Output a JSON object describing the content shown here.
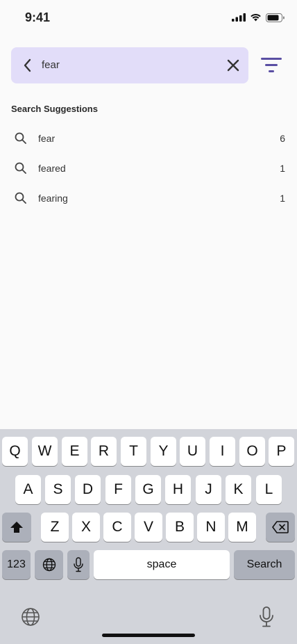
{
  "status_bar": {
    "time": "9:41"
  },
  "search": {
    "query": "fear"
  },
  "suggestions": {
    "title": "Search Suggestions",
    "items": [
      {
        "word": "fear",
        "count": "6"
      },
      {
        "word": "feared",
        "count": "1"
      },
      {
        "word": "fearing",
        "count": "1"
      }
    ]
  },
  "keyboard": {
    "row1": [
      "Q",
      "W",
      "E",
      "R",
      "T",
      "Y",
      "U",
      "I",
      "O",
      "P"
    ],
    "row2": [
      "A",
      "S",
      "D",
      "F",
      "G",
      "H",
      "J",
      "K",
      "L"
    ],
    "row3": [
      "Z",
      "X",
      "C",
      "V",
      "B",
      "N",
      "M"
    ],
    "numbers_label": "123",
    "space_label": "space",
    "return_label": "Search"
  },
  "colors": {
    "accent": "#5a4fa3",
    "search_bg": "#e2ddf9"
  },
  "icons": [
    "back-chevron-icon",
    "clear-x-icon",
    "filter-icon",
    "search-icon",
    "shift-icon",
    "backspace-icon",
    "globe-icon",
    "microphone-icon"
  ]
}
